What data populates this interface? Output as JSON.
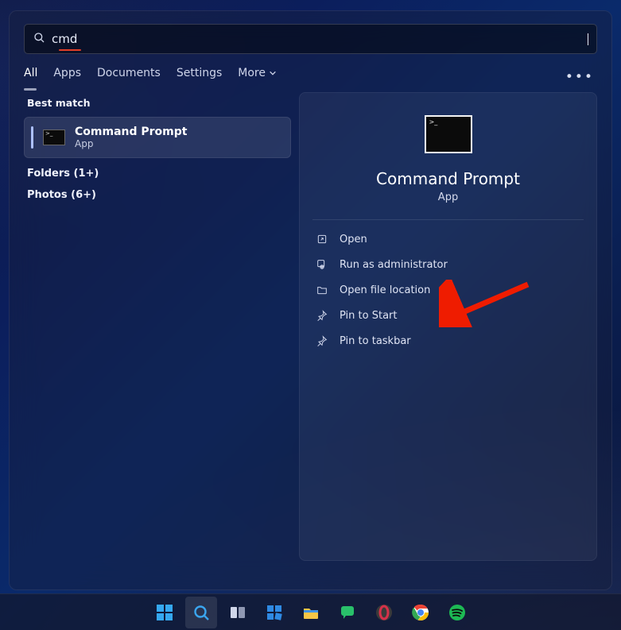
{
  "search": {
    "value": "cmd",
    "placeholder": ""
  },
  "tabs": {
    "all": "All",
    "apps": "Apps",
    "documents": "Documents",
    "settings": "Settings",
    "more": "More"
  },
  "sections": {
    "best_match": "Best match",
    "folders": "Folders (1+)",
    "photos": "Photos (6+)"
  },
  "best_match": {
    "title": "Command Prompt",
    "subtitle": "App"
  },
  "detail": {
    "title": "Command Prompt",
    "subtitle": "App",
    "actions": {
      "open": "Open",
      "run_admin": "Run as administrator",
      "open_location": "Open file location",
      "pin_start": "Pin to Start",
      "pin_taskbar": "Pin to taskbar"
    }
  },
  "icons": {
    "search": "search-icon",
    "more_dots": "more-dots-icon",
    "chevron_down": "chevron-down-icon",
    "open": "open-icon",
    "shield": "admin-icon",
    "folder": "folder-icon",
    "pin_start": "pin-start-icon",
    "pin_taskbar": "pin-taskbar-icon"
  },
  "taskbar": {
    "items": [
      {
        "name": "start-button"
      },
      {
        "name": "search-button",
        "active": true
      },
      {
        "name": "task-view-button"
      },
      {
        "name": "widgets-button"
      },
      {
        "name": "file-explorer-button"
      },
      {
        "name": "chat-button"
      },
      {
        "name": "app-opera-button"
      },
      {
        "name": "chrome-button"
      },
      {
        "name": "spotify-button"
      }
    ]
  }
}
